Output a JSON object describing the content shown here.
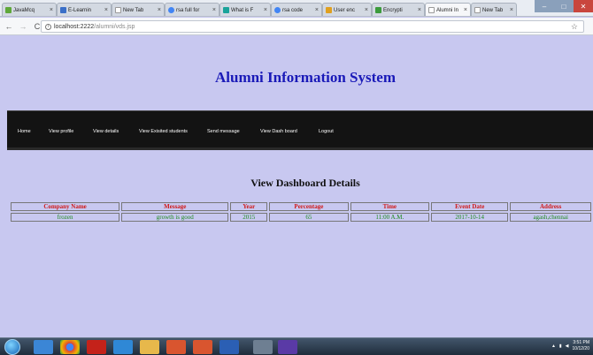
{
  "browser": {
    "tabs": [
      {
        "label": "JavaMcq",
        "icon": "green-page-icon"
      },
      {
        "label": "E-Learnin",
        "icon": "blue-page-icon"
      },
      {
        "label": "New Tab",
        "icon": "blank-page-icon"
      },
      {
        "label": "rsa full for",
        "icon": "google-icon"
      },
      {
        "label": "What is F",
        "icon": "teal-square-icon"
      },
      {
        "label": "rsa code",
        "icon": "google-icon"
      },
      {
        "label": "User enc",
        "icon": "grid-icon"
      },
      {
        "label": "Encrypti",
        "icon": "green-grid-icon"
      },
      {
        "label": "Alumni In",
        "icon": "blank-page-icon"
      },
      {
        "label": "New Tab",
        "icon": "blank-page-icon"
      }
    ],
    "close_glyph": "×",
    "url_host": "localhost:2222",
    "url_path": "/alumni/vds.jsp"
  },
  "page": {
    "title": "Alumni Information System",
    "nav": [
      "Home",
      "View profile",
      "View details",
      "View Exisited students",
      "Send message",
      "View Dash board",
      "Logout"
    ],
    "section_title": "View Dashboard Details"
  },
  "table": {
    "headers": [
      "Company Name",
      "Message",
      "Year",
      "Percentage",
      "Time",
      "Event Date",
      "Address"
    ],
    "rows": [
      [
        "frozen",
        "growth is good",
        "2015",
        "65",
        "11:00 A.M.",
        "2017-10-14",
        "agash,chennai"
      ]
    ]
  },
  "taskbar": {
    "time": "3:51 PM",
    "date": "10/12/20"
  },
  "colors": {
    "page_bg": "#c8c8f0",
    "title": "#1a1ab8",
    "navbar": "#131313",
    "header_text": "#d01818",
    "cell_text": "#1c8a1c"
  }
}
